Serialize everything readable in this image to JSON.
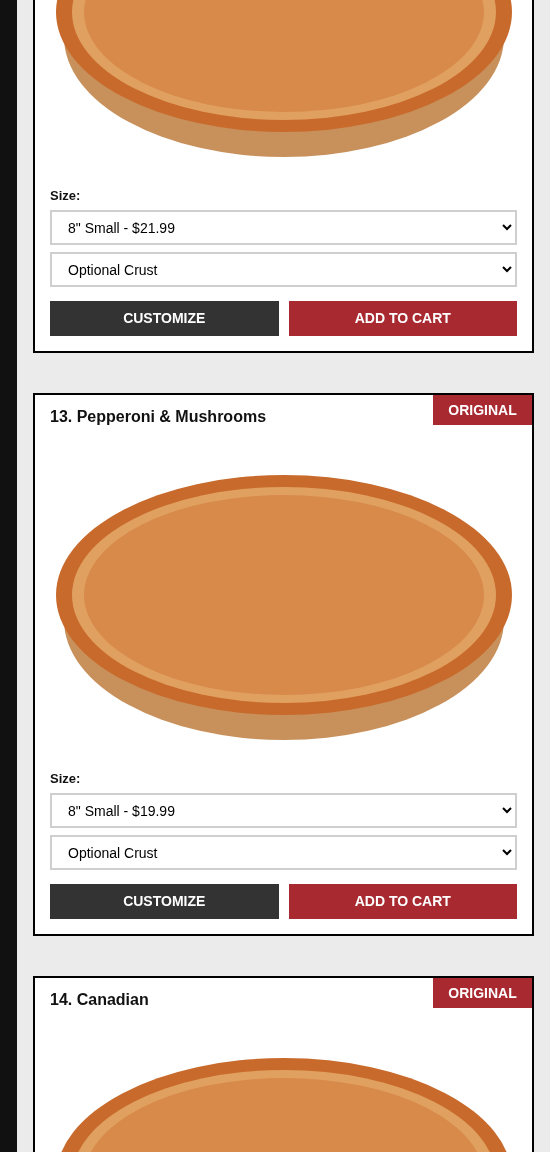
{
  "products": [
    {
      "size_label": "Size:",
      "size": "8\" Small - $21.99",
      "crust": "Optional Crust",
      "buttons": [
        {
          "label": "CUSTOMIZE",
          "kind": "secondary"
        },
        {
          "label": "ADD TO CART",
          "kind": "primary"
        }
      ]
    },
    {
      "title": "13. Pepperoni & Mushrooms",
      "badge": "ORIGINAL",
      "size_label": "Size:",
      "size": "8\" Small - $19.99",
      "crust": "Optional Crust",
      "buttons": [
        {
          "label": "CUSTOMIZE",
          "kind": "secondary"
        },
        {
          "label": "ADD TO CART",
          "kind": "primary"
        }
      ]
    },
    {
      "title": "14. Canadian",
      "badge": "ORIGINAL"
    }
  ]
}
